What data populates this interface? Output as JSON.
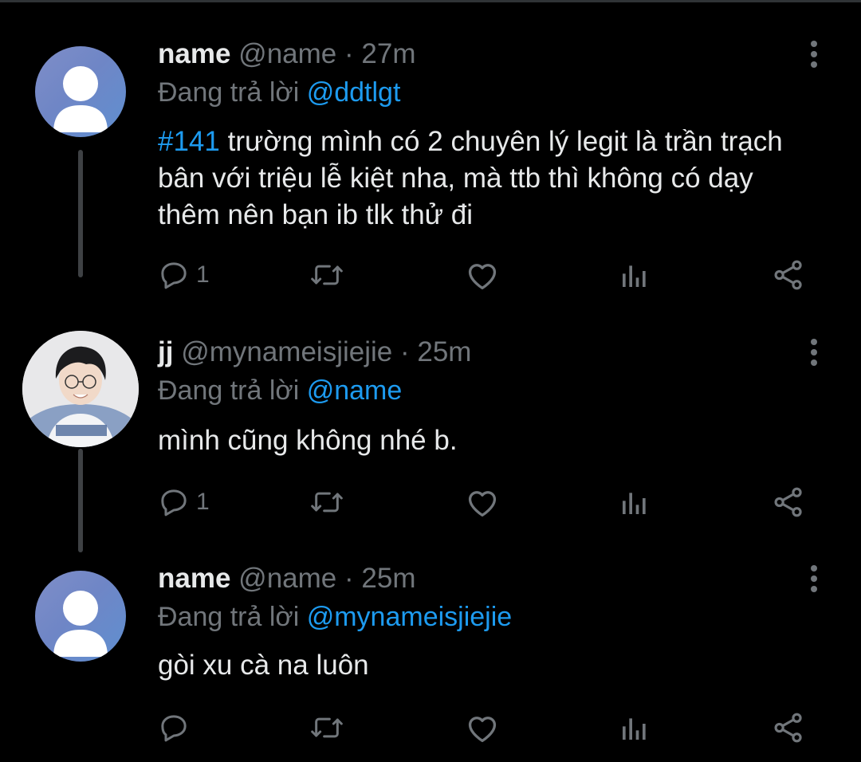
{
  "colors": {
    "background": "#000000",
    "text": "#e7e9ea",
    "secondary": "#71767b",
    "accent": "#1d9bf0",
    "thread_line": "#3e4144"
  },
  "tweets": [
    {
      "display_name": "name",
      "handle": "@name",
      "separator": "·",
      "time": "27m",
      "reply_prefix": "Đang trả lời",
      "reply_to": "@ddtlgt",
      "hashtag": "#141",
      "text": "trường mình có 2 chuyên lý legit là trần trạch bân với triệu lễ kiệt nha, mà ttb thì không có dạy thêm nên bạn ib tlk thử đi",
      "reply_count": "1",
      "avatar": "default-avatar"
    },
    {
      "display_name": "jj",
      "handle": "@mynameisjiejie",
      "separator": "·",
      "time": "25m",
      "reply_prefix": "Đang trả lời",
      "reply_to": "@name",
      "text": "mình cũng không nhé b.",
      "reply_count": "1",
      "avatar": "photo-avatar"
    },
    {
      "display_name": "name",
      "handle": "@name",
      "separator": "·",
      "time": "25m",
      "reply_prefix": "Đang trả lời",
      "reply_to": "@mynameisjiejie",
      "text": "gòi xu cà na luôn",
      "reply_count": "",
      "avatar": "default-avatar"
    }
  ],
  "icons": [
    "reply-icon",
    "retweet-icon",
    "like-icon",
    "views-icon",
    "share-icon",
    "more-icon"
  ]
}
